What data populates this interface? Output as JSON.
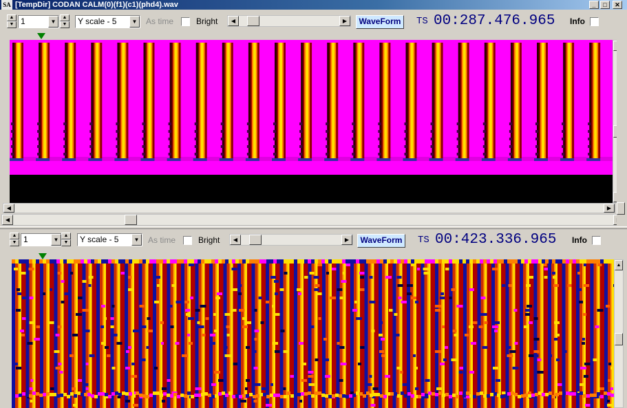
{
  "window": {
    "app_icon": "SA",
    "title": "[TempDir] CODAN CALM(0)(f1)(c1)(phd4).wav",
    "controls": [
      "minimize-icon",
      "maximize-icon",
      "close-icon"
    ]
  },
  "panels": [
    {
      "channel_value": "1",
      "yscale_value": "Y scale - 5",
      "astime_label": "As time",
      "bright_label": "Bright",
      "waveform_label": "WaveForm",
      "ts_prefix": "TS",
      "ts_value": "00:287.476.965",
      "info_label": "Info"
    },
    {
      "channel_value": "1",
      "yscale_value": "Y scale - 5",
      "astime_label": "As time",
      "bright_label": "Bright",
      "waveform_label": "WaveForm",
      "ts_prefix": "TS",
      "ts_value": "00:423.336.965",
      "info_label": "Info"
    }
  ],
  "colors": {
    "title_bar": "#0a246a",
    "spectrogram_background_top": "#ff00ff",
    "spectrogram_stripe_core": "#ffe000",
    "spectrogram_stripe_edge": "#b00000",
    "spectrogram_low": "#1010a0",
    "marker": "#008000"
  },
  "icons": {
    "spin_up": "spin-up-icon",
    "spin_down": "spin-down-icon",
    "dropdown": "chevron-down-icon",
    "scroll_left": "arrow-left-icon",
    "scroll_right": "arrow-right-icon",
    "scroll_up": "arrow-up-icon",
    "scroll_down": "arrow-down-icon",
    "position_marker": "triangle-down-icon"
  }
}
